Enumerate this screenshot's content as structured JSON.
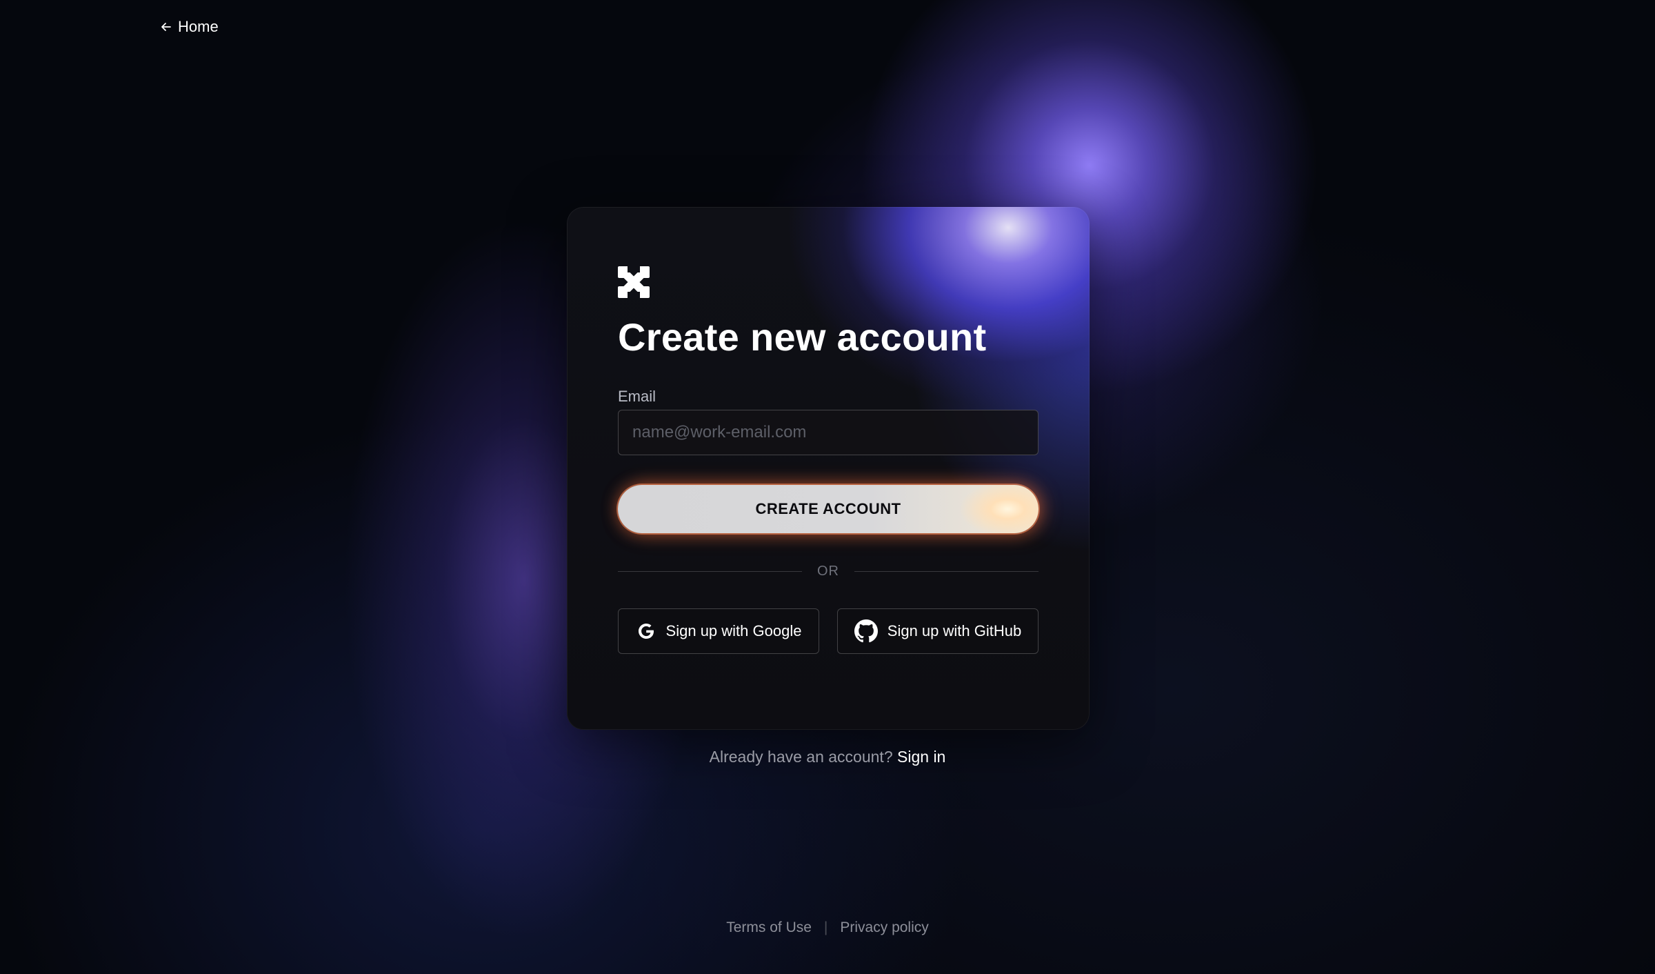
{
  "nav": {
    "home_label": "Home",
    "back_icon": "arrow-left-icon"
  },
  "card": {
    "logo_icon": "brand-logo-icon",
    "title": "Create new account",
    "email_label": "Email",
    "email_placeholder": "name@work-email.com",
    "email_value": "",
    "create_button_label": "CREATE ACCOUNT",
    "divider_label": "OR",
    "google_button_label": "Sign up with Google",
    "google_icon": "google-icon",
    "github_button_label": "Sign up with GitHub",
    "github_icon": "github-icon"
  },
  "signin": {
    "prompt": "Already have an account?",
    "link_label": "Sign in"
  },
  "footer": {
    "terms_label": "Terms of Use",
    "separator": "|",
    "privacy_label": "Privacy policy"
  },
  "colors": {
    "background": "#05070d",
    "card_glow": "#8a78ff",
    "button_glow": "#ff7a45"
  }
}
